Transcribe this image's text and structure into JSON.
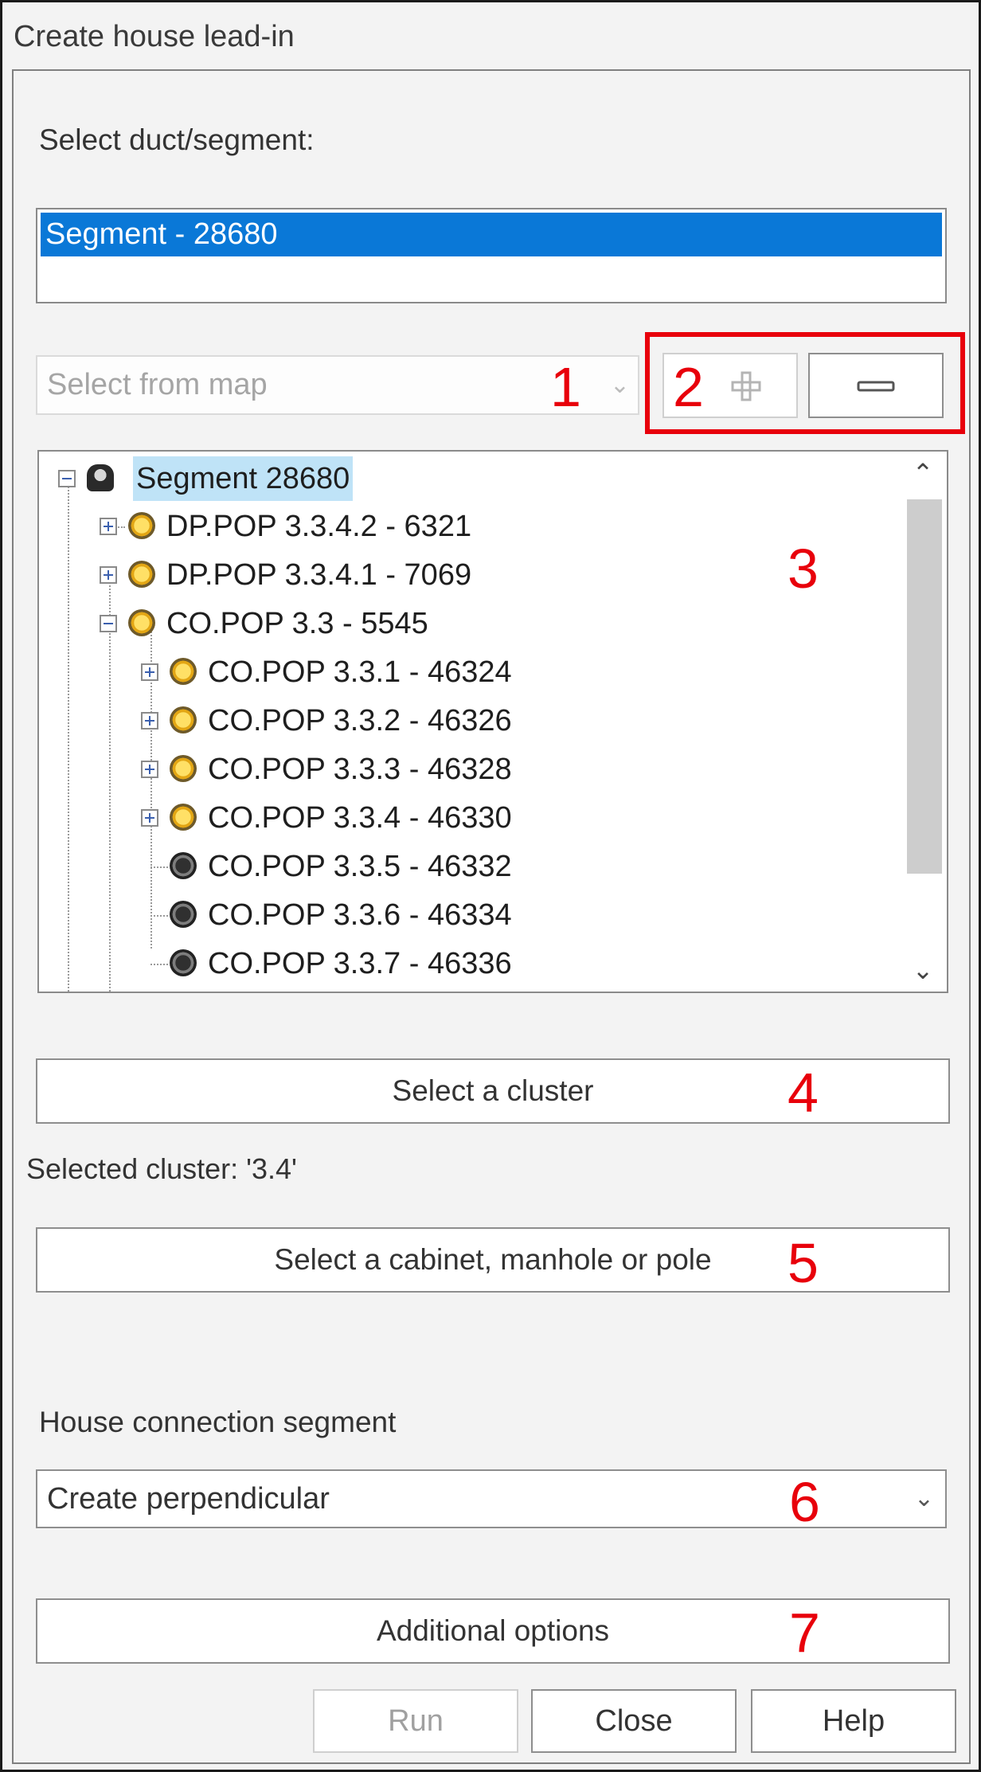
{
  "window": {
    "title": "Create house lead-in"
  },
  "duct": {
    "label": "Select duct/segment:",
    "items": [
      "Segment - 28680"
    ]
  },
  "map_select": {
    "placeholder": "Select from map",
    "chevron_icon": "chevron-down-icon"
  },
  "buttons": {
    "add_icon": "plus-icon",
    "remove_icon": "minus-icon"
  },
  "tree": {
    "root": "Segment 28680",
    "items": [
      {
        "label": "DP.POP 3.3.4.2 - 6321",
        "icon": "yellow-node-icon"
      },
      {
        "label": "DP.POP 3.3.4.1 - 7069",
        "icon": "yellow-node-icon"
      },
      {
        "label": "CO.POP 3.3 - 5545",
        "icon": "yellow-node-icon"
      },
      {
        "label": "CO.POP 3.3.1 - 46324",
        "icon": "yellow-node-icon"
      },
      {
        "label": "CO.POP 3.3.2 - 46326",
        "icon": "yellow-node-icon"
      },
      {
        "label": "CO.POP 3.3.3 - 46328",
        "icon": "yellow-node-icon"
      },
      {
        "label": "CO.POP 3.3.4 - 46330",
        "icon": "yellow-node-icon"
      },
      {
        "label": "CO.POP 3.3.5 - 46332",
        "icon": "black-node-icon"
      },
      {
        "label": "CO.POP 3.3.6 - 46334",
        "icon": "black-node-icon"
      },
      {
        "label": "CO.POP 3.3.7 - 46336",
        "icon": "black-node-icon"
      }
    ]
  },
  "cluster": {
    "button": "Select a cluster",
    "selected_text": "Selected cluster: '3.4'"
  },
  "cabinet": {
    "button": "Select a cabinet, manhole or pole"
  },
  "house_connection": {
    "label": "House connection segment",
    "value": "Create perpendicular"
  },
  "additional": {
    "button": "Additional options"
  },
  "footer": {
    "run": "Run",
    "close": "Close",
    "help": "Help"
  },
  "annotations": [
    "1",
    "2",
    "3",
    "4",
    "5",
    "6",
    "7"
  ],
  "colors": {
    "selection": "#0a78d7",
    "annotation": "#e8000b",
    "tree_highlight": "#bfe3f7"
  }
}
